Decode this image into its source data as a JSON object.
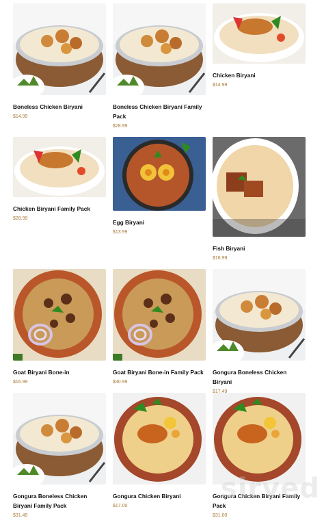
{
  "menu": {
    "items": [
      {
        "name": "Boneless Chicken Biryani",
        "price": "$14.99",
        "image": "handi-biryani"
      },
      {
        "name": "Boneless Chicken Biryani Family Pack",
        "price": "$28.99",
        "image": "handi-biryani"
      },
      {
        "name": "Chicken Biryani",
        "price": "$14.99",
        "image": "plate-chicken-biryani"
      },
      {
        "name": "Chicken Biryani Family Pack",
        "price": "$28.99",
        "image": "plate-chicken-biryani"
      },
      {
        "name": "Egg Biryani",
        "price": "$13.99",
        "image": "egg-biryani"
      },
      {
        "name": "Fish Biryani",
        "price": "$16.99",
        "image": "fish-biryani"
      },
      {
        "name": "Goat Biryani Bone-in",
        "price": "$16.99",
        "image": "clay-pot-goat-biryani"
      },
      {
        "name": "Goat Biryani Bone-in Family Pack",
        "price": "$30.99",
        "image": "clay-pot-goat-biryani"
      },
      {
        "name": "Gongura Boneless Chicken Biryani",
        "price": "$17.49",
        "image": "handi-biryani"
      },
      {
        "name": "Gongura Boneless Chicken Biryani Family Pack",
        "price": "$31.49",
        "image": "handi-biryani"
      },
      {
        "name": "Gongura Chicken Biryani",
        "price": "$17.00",
        "image": "clay-pot-chicken-biryani"
      },
      {
        "name": "Gongura Chicken Biryani Family Pack",
        "price": "$31.00",
        "image": "clay-pot-chicken-biryani"
      }
    ]
  },
  "watermark": "sirved"
}
